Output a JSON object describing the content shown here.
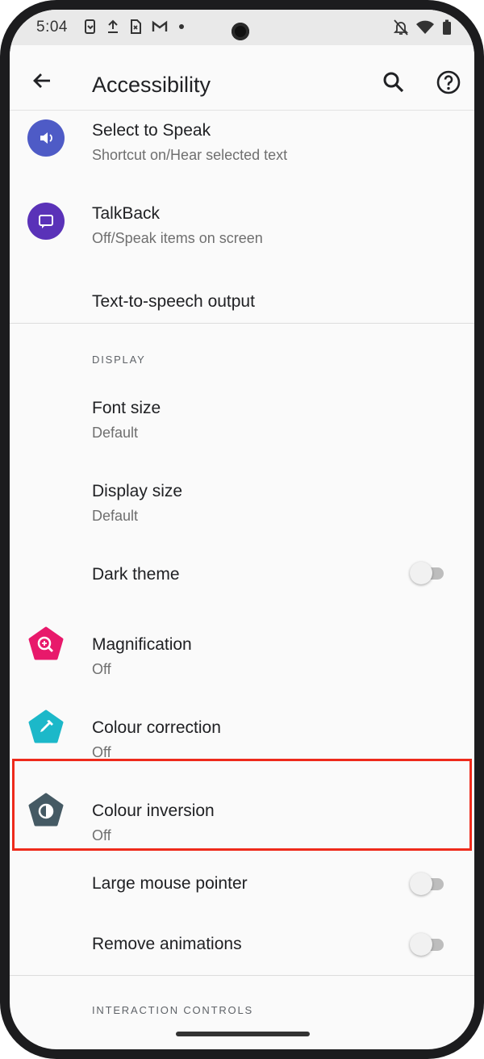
{
  "status_bar": {
    "time": "5:04",
    "left_icons": [
      "screenshot-icon",
      "upload-icon",
      "sim-icon",
      "gmail-icon",
      "dot-icon"
    ],
    "right_icons": [
      "notifications-off-icon",
      "wifi-icon",
      "battery-icon"
    ]
  },
  "app_bar": {
    "title": "Accessibility"
  },
  "items": {
    "select_to_speak": {
      "title": "Select to Speak",
      "subtitle": "Shortcut on/Hear selected text"
    },
    "talkback": {
      "title": "TalkBack",
      "subtitle": "Off/Speak items on screen"
    },
    "tts": {
      "title": "Text-to-speech output"
    },
    "font_size": {
      "title": "Font size",
      "subtitle": "Default"
    },
    "display_size": {
      "title": "Display size",
      "subtitle": "Default"
    },
    "dark_theme": {
      "title": "Dark theme",
      "enabled": false
    },
    "magnification": {
      "title": "Magnification",
      "subtitle": "Off"
    },
    "colour_correction": {
      "title": "Colour correction",
      "subtitle": "Off"
    },
    "colour_inversion": {
      "title": "Colour inversion",
      "subtitle": "Off"
    },
    "large_mouse_pointer": {
      "title": "Large mouse pointer",
      "enabled": false
    },
    "remove_animations": {
      "title": "Remove animations",
      "enabled": false
    }
  },
  "sections": {
    "display": "DISPLAY",
    "interaction_controls": "INTERACTION CONTROLS"
  },
  "colors": {
    "select_to_speak_icon": "#4e5bc6",
    "talkback_icon": "#5a32b8",
    "magnification_icon": "#e8196b",
    "colour_correction_icon": "#1cb8c9",
    "colour_inversion_icon": "#455a64",
    "highlight_border": "#ee2a1b"
  }
}
